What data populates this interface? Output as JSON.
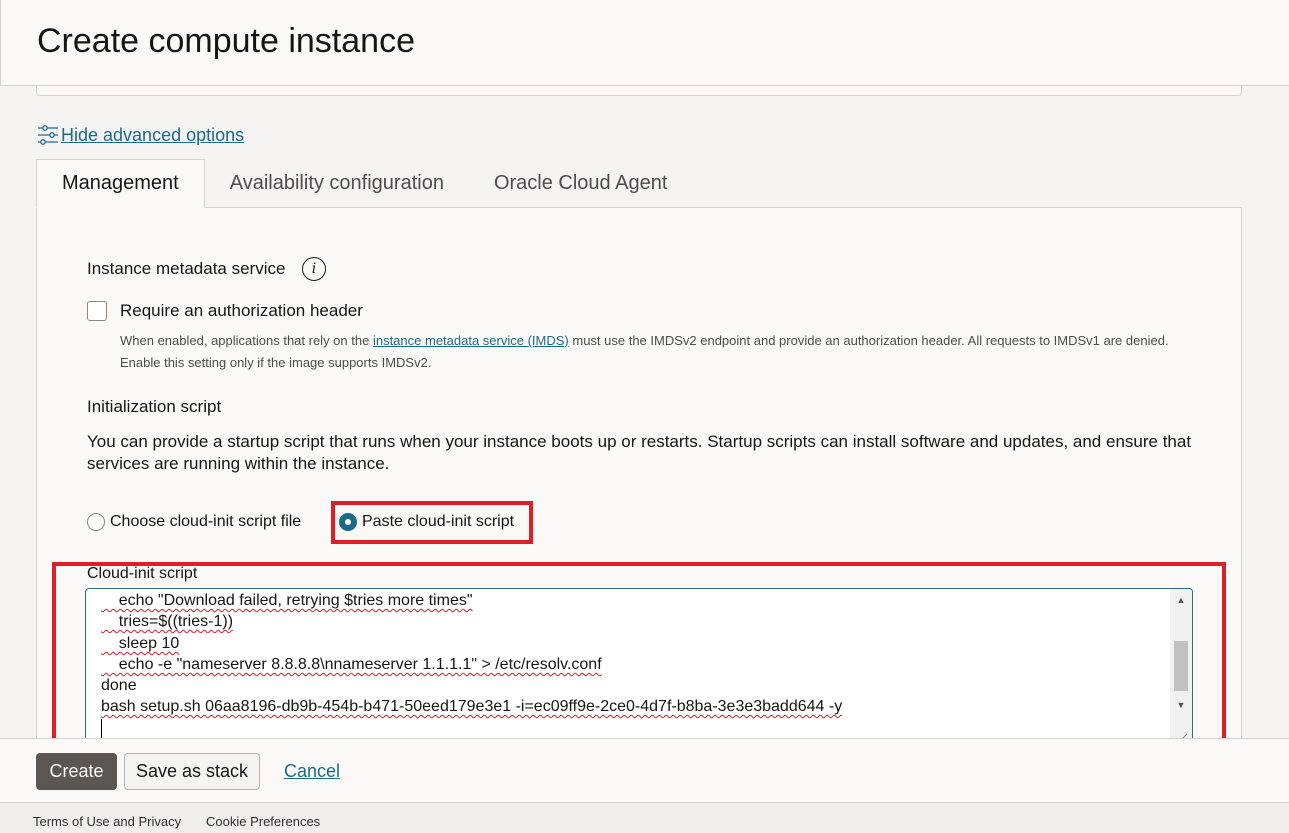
{
  "page": {
    "title": "Create compute instance"
  },
  "advanced": {
    "toggle_label": "Hide advanced options"
  },
  "tabs": [
    {
      "label": "Management",
      "active": true
    },
    {
      "label": "Availability configuration",
      "active": false
    },
    {
      "label": "Oracle Cloud Agent",
      "active": false
    }
  ],
  "metadata": {
    "title": "Instance metadata service",
    "checkbox_label": "Require an authorization header",
    "checkbox_checked": false,
    "help_before": "When enabled, applications that rely on the ",
    "help_link": "instance metadata service (IMDS)",
    "help_after": " must use the IMDSv2 endpoint and provide an authorization header. All requests to IMDSv1 are denied. Enable this setting only if the image supports IMDSv2."
  },
  "init": {
    "title": "Initialization script",
    "description": "You can provide a startup script that runs when your instance boots up or restarts. Startup scripts can install software and updates, and ensure that services are running within the instance.",
    "options": [
      {
        "label": "Choose cloud-init script file",
        "selected": false
      },
      {
        "label": "Paste cloud-init script",
        "selected": true
      }
    ],
    "script_label": "Cloud-init script",
    "script_lines": [
      "    echo \"Download failed, retrying $tries more times\"",
      "    tries=$((tries-1))",
      "    sleep 10",
      "    echo -e \"nameserver 8.8.8.8\\nnameserver 1.1.1.1\" > /etc/resolv.conf",
      "done",
      "bash setup.sh 06aa8196-db9b-454b-b471-50eed179e3e1 -i=ec09ff9e-2ce0-4d7f-b8ba-3e3e3badd644 -y"
    ]
  },
  "footer": {
    "create_label": "Create",
    "stack_label": "Save as stack",
    "cancel_label": "Cancel"
  },
  "bottom_links": {
    "terms": "Terms of Use and Privacy",
    "cookies": "Cookie Preferences"
  },
  "colors": {
    "accent": "#1a6a8a",
    "highlight": "#e01e2a",
    "primary_button": "#5b5652"
  }
}
